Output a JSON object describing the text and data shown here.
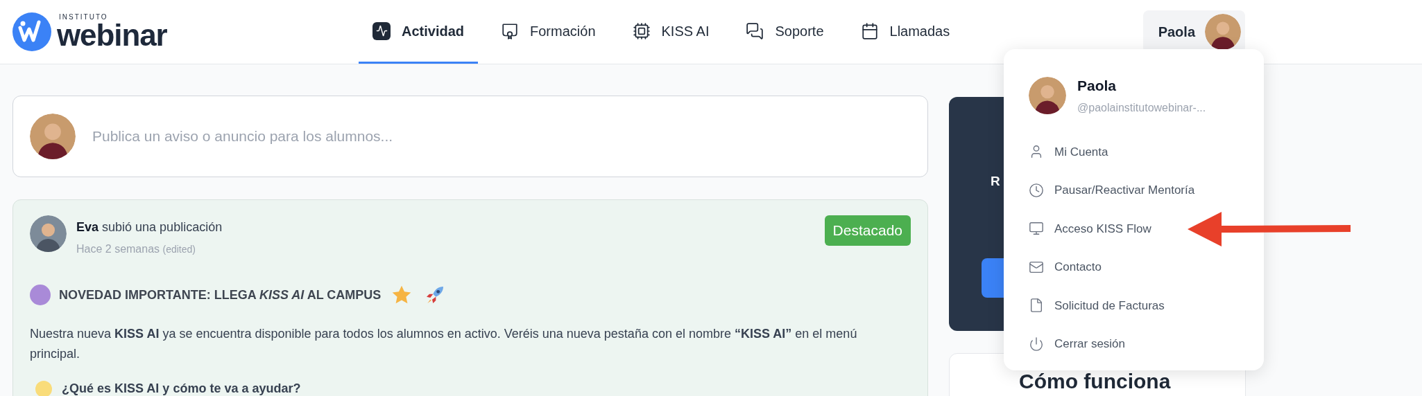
{
  "header": {
    "logo": {
      "small": "INSTITUTO",
      "name": "webinar"
    },
    "nav": [
      {
        "label": "Actividad",
        "selected": true
      },
      {
        "label": "Formación",
        "selected": false
      },
      {
        "label": "KISS AI",
        "selected": false
      },
      {
        "label": "Soporte",
        "selected": false
      },
      {
        "label": "Llamadas",
        "selected": false
      }
    ],
    "profile": {
      "name": "Paola"
    }
  },
  "composer": {
    "placeholder": "Publica un aviso o anuncio para los alumnos..."
  },
  "post": {
    "author": "Eva",
    "action": "subió una publicación",
    "time": "Hace 2 semanas",
    "edited": "(edited)",
    "badge": "Destacado",
    "title": "NOVEDAD IMPORTANTE: LLEGA *KISS AI* AL CAMPUS",
    "body": "Nuestra nueva **KISS AI** ya se encuentra disponible para todos los alumnos en activo. Veréis una nueva pestaña con el nombre **“KISS AI”** en el menú principal.",
    "question": "¿Qué es KISS AI y cómo te va a ayudar?"
  },
  "promo": {
    "text": "R"
  },
  "howto": {
    "title": "Cómo funciona"
  },
  "menu": {
    "name": "Paola",
    "handle": "@paolainstitutowebinar-...",
    "items": [
      {
        "label": "Mi Cuenta"
      },
      {
        "label": "Pausar/Reactivar Mentoría"
      },
      {
        "label": "Acceso KISS Flow"
      },
      {
        "label": "Contacto"
      },
      {
        "label": "Solicitud de Facturas"
      },
      {
        "label": "Cerrar sesión"
      }
    ]
  }
}
